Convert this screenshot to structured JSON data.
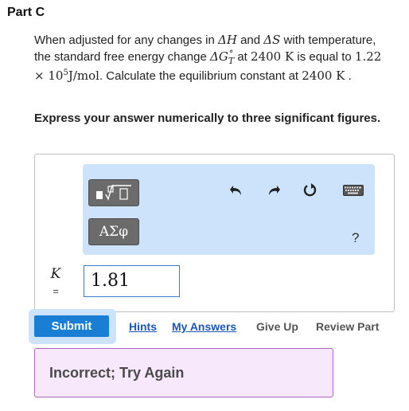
{
  "part_title": "Part C",
  "question": {
    "t1": "When adjusted for any changes in ",
    "dH": "ΔH",
    "t2": " and ",
    "dS": "ΔS",
    "t3": " with temperature, the standard free energy change ",
    "dG": "ΔG",
    "dG_sup": "°",
    "dG_sub": "T",
    "t4": " at ",
    "temp1": "2400 K",
    "t5": " is equal to ",
    "value": "1.22 × 10",
    "value_exp": "5",
    "units": "J/mol",
    "t6": ". Calculate the equilibrium constant at ",
    "temp2": "2400 K",
    "t7": " ."
  },
  "instruction": "Express your answer numerically to three significant figures.",
  "toolbar": {
    "templates_icon": "fraction-root-template-icon",
    "symbols_label": "ΑΣφ",
    "undo_icon": "undo-icon",
    "redo_icon": "redo-icon",
    "reset_icon": "reset-icon",
    "keyboard_icon": "keyboard-icon",
    "help_label": "?"
  },
  "answer": {
    "variable": "K",
    "equals": "=",
    "value": "1.81"
  },
  "actions": {
    "submit": "Submit",
    "hints": "Hints",
    "my_answers": "My Answers",
    "give_up": "Give Up",
    "review_part": "Review Part"
  },
  "feedback": "Incorrect; Try Again",
  "colors": {
    "accent": "#1a7fd4",
    "toolbar_bg": "#cde2fb",
    "feedback_bg": "#f7e8fc",
    "feedback_border": "#a86ac1"
  }
}
